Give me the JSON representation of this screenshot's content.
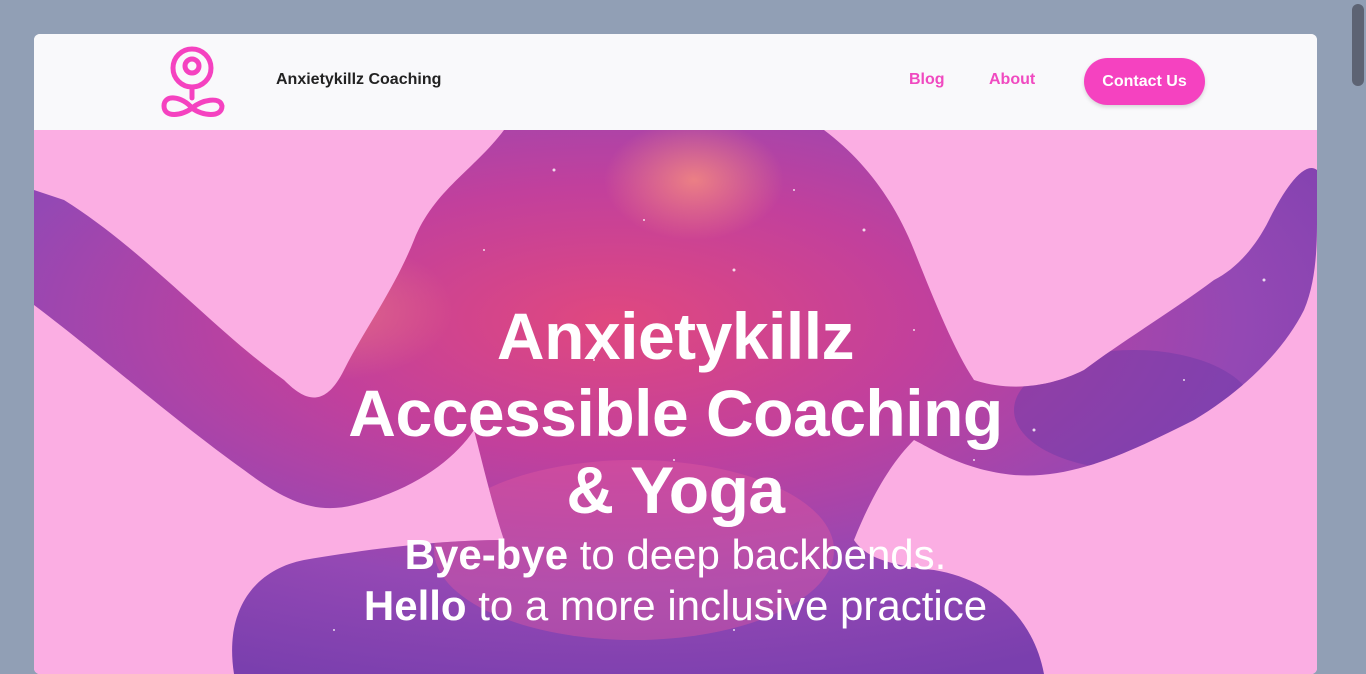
{
  "header": {
    "brand_name": "Anxietykillz Coaching",
    "logo_icon": "meditation-logo-icon",
    "nav": {
      "blog_label": "Blog",
      "about_label": "About",
      "contact_label": "Contact Us"
    }
  },
  "hero": {
    "title_line1": "Anxietykillz",
    "title_line2": "Accessible Coaching",
    "title_line3": "& Yoga",
    "sub1_bold": "Bye-bye",
    "sub1_rest": " to deep backbends.",
    "sub2_bold": "Hello",
    "sub2_rest": " to a more inclusive practice",
    "background_image": "galaxy-meditation-silhouette"
  },
  "colors": {
    "accent": "#f542c0",
    "hero_bg": "#fbaee3",
    "page_bg": "#919fb5"
  }
}
